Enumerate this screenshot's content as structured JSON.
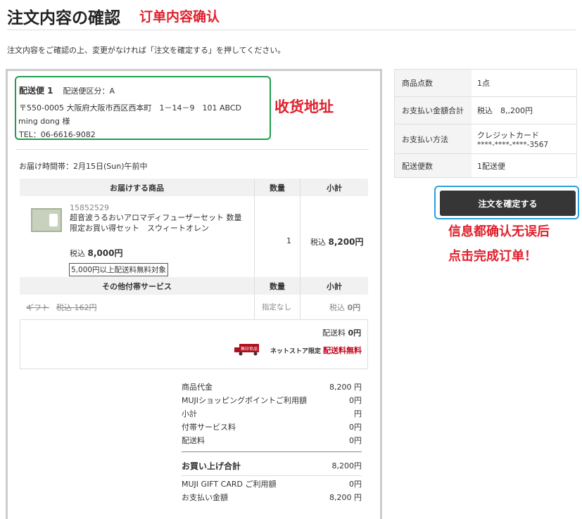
{
  "header": {
    "title_jp": "注文内容の確認",
    "title_cn": "订单内容确认",
    "notice": "注文内容をご確認の上、変更がなければ「注文を確定する」を押してください。"
  },
  "shipment": {
    "label": "配送便 1",
    "category": "配送便区分：A",
    "postal_address": "〒550-0005 大阪府大阪市西区西本町　1－14－9　101 ABCD",
    "recipient": "ming dong 様",
    "tel": "TEL：06-6616-9082",
    "annotation": "收货地址",
    "delivery_time": "お届け時間帯：2月15日(Sun)午前中"
  },
  "items_table": {
    "headers": [
      "お届けする商品",
      "数量",
      "小計"
    ],
    "product": {
      "code": "15852529",
      "name": "超音波うるおいアロマディフューザーセット 数量限定お買い得セット　スウィートオレン",
      "price_prefix": "税込",
      "price": "8,000円",
      "badge": "5,000円以上配送料無料対象",
      "quantity": "1",
      "subtotal_prefix": "税込",
      "subtotal": "8,200円"
    }
  },
  "services_table": {
    "headers": [
      "その他付帯サービス",
      "数量",
      "小計"
    ],
    "row": {
      "name": "ギフト",
      "price": "税込 162円",
      "quantity": "指定なし",
      "subtotal_prefix": "税込",
      "subtotal": "0円"
    }
  },
  "shipping": {
    "fee_label": "配送料",
    "fee_value": "0円",
    "truck_text": "無印良品",
    "netstore": "ネットストア限定",
    "free_label": "配送料無料"
  },
  "summary": {
    "rows": [
      {
        "label": "商品代金",
        "value": "8,200 円"
      },
      {
        "label": "MUJIショッピングポイントご利用額",
        "value": "0円"
      },
      {
        "label": "小計",
        "value": "円"
      },
      {
        "label": "付帯サービス料",
        "value": "0円"
      },
      {
        "label": "配送料",
        "value": "0円"
      }
    ],
    "total_label": "お買い上げ合計",
    "total_value": "8,200円",
    "rows2": [
      {
        "label": "MUJI GIFT CARD ご利用額",
        "value": "0円"
      },
      {
        "label": "お支払い金額",
        "value": "8,200 円"
      }
    ]
  },
  "side": {
    "rows": [
      {
        "label": "商品点数",
        "value": "1点",
        "value2": ""
      },
      {
        "label": "お支払い金額合計",
        "value": "税込　8,,200円",
        "value2": ""
      },
      {
        "label": "お支払い方法",
        "value": "クレジットカード",
        "value2": "****-****-****-3567"
      },
      {
        "label": "配送便数",
        "value": "1配送便",
        "value2": ""
      }
    ],
    "confirm_button": "注文を確定する",
    "annotation_line1": "信息都确认无误后",
    "annotation_line2": "点击完成订单！"
  },
  "colors": {
    "annotation_red": "#e0202c",
    "address_box_green": "#1f9e4f",
    "button_frame_blue": "#2aa0e0",
    "button_bg": "#363636",
    "free_shipping_red": "#c4001a"
  }
}
